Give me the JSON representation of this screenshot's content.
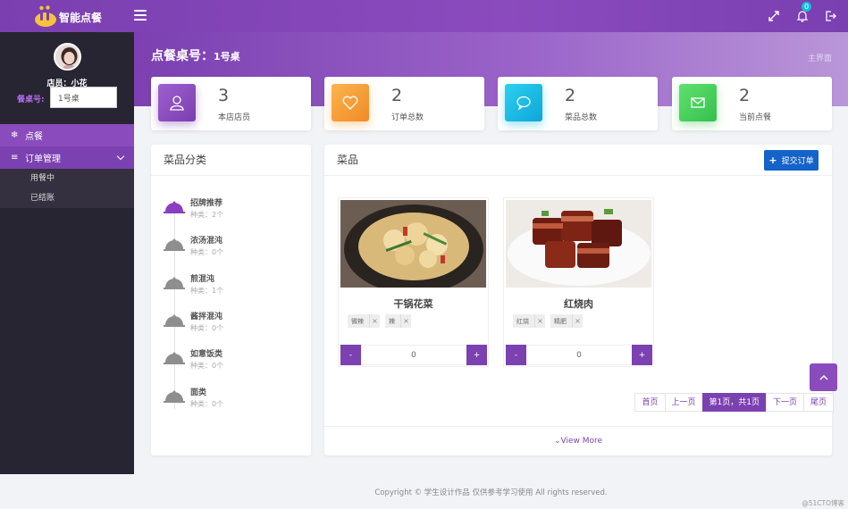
{
  "app": {
    "logo_text": "智能点餐"
  },
  "topbar": {
    "notification_count": "0"
  },
  "sidebar": {
    "staff_label": "店员：小花",
    "table_label": "餐桌号:",
    "table_input_value": "1号桌",
    "items": [
      {
        "label": "点餐",
        "icon": "snowflake-icon"
      },
      {
        "label": "订单管理",
        "icon": "database-icon"
      }
    ],
    "sub_items": [
      {
        "label": "用餐中"
      },
      {
        "label": "已结账"
      }
    ]
  },
  "page": {
    "title": "点餐桌号：",
    "table": "1号桌",
    "breadcrumb": "主界面"
  },
  "stats": [
    {
      "value": "3",
      "label": "本店店员",
      "icon": "user-icon",
      "color": "#8b4bbd"
    },
    {
      "value": "2",
      "label": "订单总数",
      "icon": "heart-icon",
      "color": "#f59a33"
    },
    {
      "value": "2",
      "label": "菜品总数",
      "icon": "chat-icon",
      "color": "#12b9e0"
    },
    {
      "value": "2",
      "label": "当前点餐",
      "icon": "mail-icon",
      "color": "#3ec955"
    }
  ],
  "categories_panel": {
    "title": "菜品分类",
    "items": [
      {
        "name": "招牌推荐",
        "count": "种类：2个"
      },
      {
        "name": "浓汤混沌",
        "count": "种类：0个"
      },
      {
        "name": "煎混沌",
        "count": "种类：1个"
      },
      {
        "name": "酱拌混沌",
        "count": "种类：0个"
      },
      {
        "name": "如意饭类",
        "count": "种类：0个"
      },
      {
        "name": "面类",
        "count": "种类：0个"
      }
    ]
  },
  "dishes_panel": {
    "title": "菜品",
    "submit_label": "提交订单",
    "dishes": [
      {
        "name": "干锅花菜",
        "tags": [
          "微辣",
          "辣"
        ],
        "qty": "0",
        "minus": "-",
        "plus": "+"
      },
      {
        "name": "红烧肉",
        "tags": [
          "红烧",
          "精肥"
        ],
        "qty": "0",
        "minus": "-",
        "plus": "+"
      }
    ],
    "pager": {
      "first": "首页",
      "prev": "上一页",
      "current": "第1页，共1页",
      "next": "下一页",
      "last": "尾页"
    },
    "view_more": "View More"
  },
  "footer": {
    "copyright": "Copyright © 学生设计作品  仅供参考学习使用 All rights reserved.",
    "watermark": "@51CTO博客"
  },
  "colors": {
    "primary": "#7b41b0",
    "sidebar": "#282533",
    "submit": "#1463c9"
  }
}
